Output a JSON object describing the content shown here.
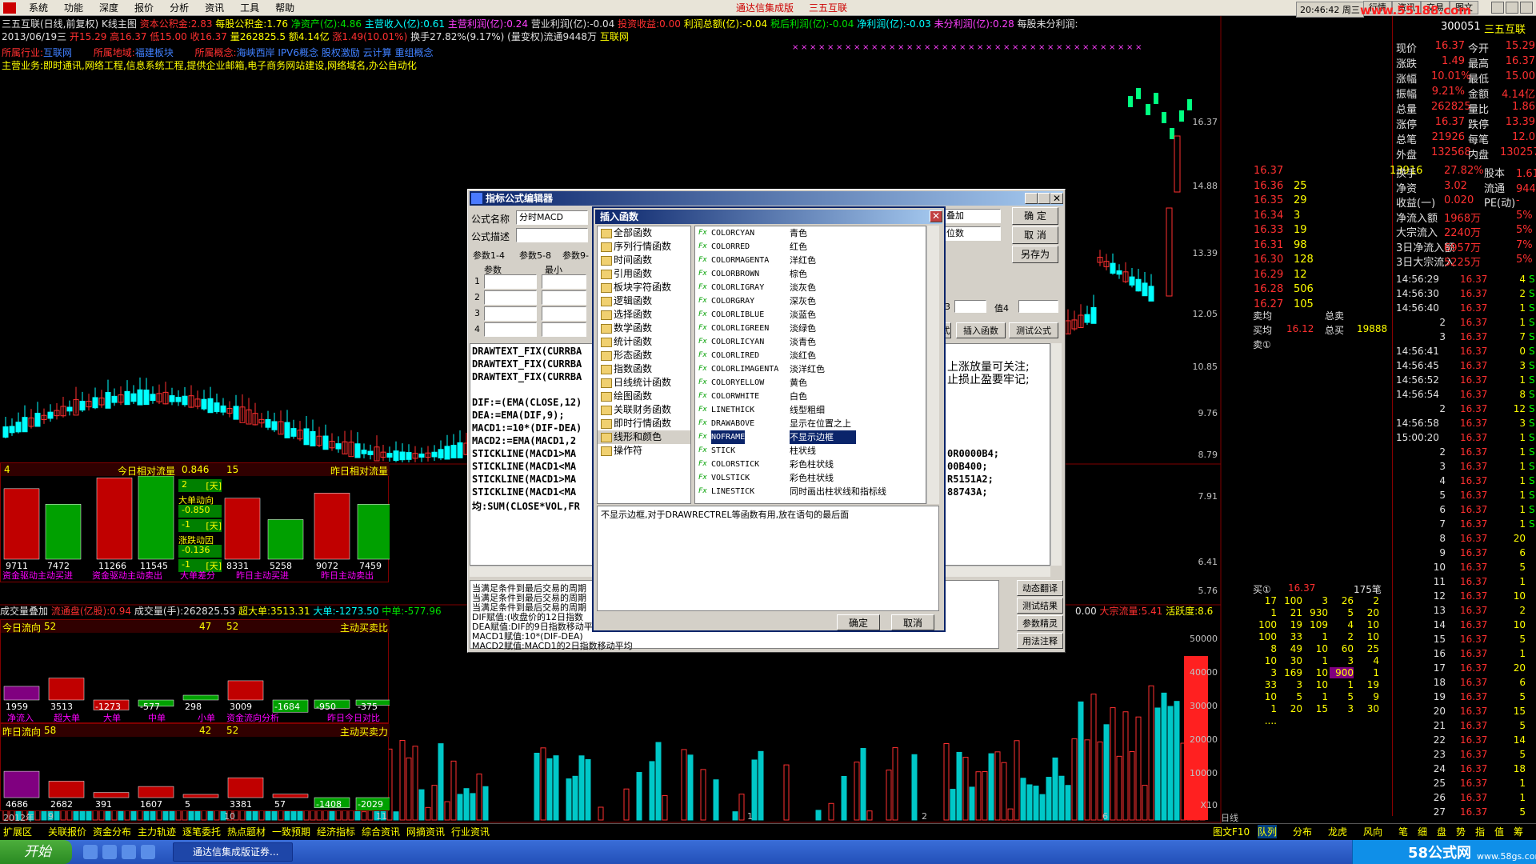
{
  "menu": {
    "items": [
      "系统",
      "功能",
      "深度",
      "报价",
      "分析",
      "资讯",
      "工具",
      "帮助"
    ],
    "center_title": "通达信集成版",
    "stock_name": "三五互联",
    "clock": "20:46:42 周三",
    "right_tabs": [
      "行情",
      "资讯",
      "交易",
      "图文"
    ]
  },
  "header": {
    "line1": {
      "stock": "三五互联(日线,前复权) K线主图",
      "f1": "资本公积金:2.83",
      "f2": "每股公积金:1.76",
      "f3": "净资产(亿):4.86",
      "f4": "主营收入(亿):0.61",
      "f5": "主营利润(亿):0.24",
      "f6": "营业利润(亿):-0.04",
      "f7": "投资收益:0.00",
      "f8": "利润总额(亿):-0.04",
      "f9": "税后利润(亿):-0.04",
      "f10": "净利润(亿):-0.03",
      "f11": "未分利润(亿):0.28",
      "f12": "每股未分利润:"
    },
    "line2": {
      "date": "2013/06/19三",
      "open": "开15.29",
      "high": "高16.37",
      "low": "低15.00",
      "close": "收16.37",
      "vol": "量262825.5",
      "amount": "额4.14亿",
      "chg": "涨1.49(10.01%)",
      "turnover": "换手27.82%(9.17%)",
      "float": "(量变权)流通9448万",
      "industry_tag": "互联网"
    },
    "line3": {
      "industry": "所属行业:",
      "industry_v": "互联网",
      "region": "所属地域:",
      "region_v": "福建板块",
      "concept": "所属概念:",
      "concept_v": "海峡西岸 IPV6概念 股权激励 云计算 重组概念"
    },
    "line4": {
      "business": "主营业务:即时通讯,网络工程,信息系统工程,提供企业邮箱,电子商务网站建设,网络域名,办公自动化"
    }
  },
  "price_axis": [
    "16.37",
    "14.88",
    "13.39",
    "12.05",
    "10.85",
    "9.76",
    "8.79",
    "7.91",
    "6.41",
    "5.76"
  ],
  "vol_axis": [
    "50000",
    "40000",
    "30000",
    "20000",
    "10000",
    "X10"
  ],
  "subpanel_top": {
    "left_title": "今日相对流量",
    "left_num": "4",
    "left_val": "0.846",
    "right_num": "15",
    "right_title": "昨日相对流量",
    "bars": [
      "9711",
      "7472",
      "11266",
      "11545",
      "8331",
      "5258",
      "9072",
      "7459"
    ],
    "labels": [
      "资金驱动主动买进",
      "资金驱动主动卖出",
      "大单差分",
      "昨日主动买进",
      "昨日主动卖出"
    ],
    "mid": [
      "2",
      "[天]",
      "大单动向",
      "-0.850",
      "-1",
      "[天]",
      "涨跌动因",
      "-0.136",
      "-1",
      "[天]"
    ]
  },
  "vol_line": {
    "text": "成交量叠加",
    "circ": "流通盘(亿股):0.94",
    "vol": "成交量(手):262825.53",
    "big": "超大单:3513.31",
    "large": "大单:-1273.50",
    "mid": "中单:-577.96",
    "right": "0.00",
    "right2": "大宗流量:5.41",
    "right3": "活跃度:8.6"
  },
  "flow_today": {
    "title": "今日流向",
    "num": "52",
    "pct": "47",
    "right_num": "52",
    "right_title": "主动买卖比",
    "vals": [
      "1959",
      "3513",
      "-1273",
      "-577",
      "298",
      "3009",
      "-1684",
      "-950",
      "-375"
    ],
    "labels": [
      "净流入",
      "超大单",
      "大单",
      "中单",
      "小单",
      "资金流向分析",
      "昨日今日对比"
    ]
  },
  "flow_yest": {
    "title": "昨日流向",
    "num": "58",
    "pct": "42",
    "right_num": "52",
    "right_title": "主动买卖力",
    "vals": [
      "4686",
      "2682",
      "391",
      "1607",
      "5",
      "3381",
      "57",
      "-1408",
      "-2029"
    ]
  },
  "date_axis": [
    "2012年",
    "9",
    "10",
    "11",
    "1",
    "2",
    "6",
    "日线"
  ],
  "bottom_tabs": [
    "扩展区",
    "关联报价",
    "资金分布",
    "主力轨迹",
    "逐笔委托",
    "热点题材",
    "一致预期",
    "经济指标",
    "综合资讯",
    "网摘资讯",
    "行业资讯"
  ],
  "right_bottom_tabs": [
    "图文F10",
    "队列",
    "分布",
    "龙虎",
    "风向",
    "笔",
    "细",
    "盘",
    "势",
    "指",
    "值",
    "筹"
  ],
  "quote": {
    "code": "300051",
    "name": "三五互联",
    "rows": [
      [
        "现价",
        "16.37",
        "今开",
        "15.29"
      ],
      [
        "涨跌",
        "1.49",
        "最高",
        "16.37"
      ],
      [
        "涨幅",
        "10.01%",
        "最低",
        "15.00"
      ],
      [
        "振幅",
        "9.21%",
        "金额",
        "4.14亿"
      ],
      [
        "总量",
        "262825",
        "量比",
        "1.86"
      ],
      [
        "涨停",
        "16.37",
        "跌停",
        "13.39"
      ],
      [
        "总笔",
        "21926",
        "每笔",
        "12.0"
      ],
      [
        "外盘",
        "132568",
        "内盘",
        "130257"
      ]
    ],
    "book": [
      [
        "16.37",
        "",
        "13916"
      ],
      [
        "16.36",
        "25",
        ""
      ],
      [
        "16.35",
        "29",
        ""
      ],
      [
        "16.34",
        "3",
        ""
      ],
      [
        "16.33",
        "19",
        ""
      ],
      [
        "16.31",
        "98",
        ""
      ],
      [
        "16.30",
        "128",
        ""
      ],
      [
        "16.29",
        "12",
        ""
      ],
      [
        "16.28",
        "506",
        ""
      ],
      [
        "16.27",
        "105",
        ""
      ]
    ],
    "stats": [
      [
        "换手",
        "27.82%",
        "股本",
        "1.61亿"
      ],
      [
        "净资",
        "3.02",
        "流通",
        "9448万"
      ],
      [
        "收益(一)",
        "0.020",
        "PE(动)",
        "-"
      ],
      [
        "净流入额",
        "1968万",
        "",
        "5%"
      ],
      [
        "大宗流入",
        "2240万",
        "",
        "5%"
      ],
      [
        "3日净流入额",
        "6957万",
        "",
        "7%"
      ],
      [
        "3日大宗流入",
        "5225万",
        "",
        "5%"
      ]
    ],
    "ask_bid": {
      "sell_avg": "卖均",
      "sell_total": "总卖",
      "buy_avg": "买均",
      "buy_avg_v": "16.12",
      "buy_total": "总买",
      "buy_total_v": "19888",
      "sell1": "卖①"
    },
    "ticks": [
      [
        "14:56:29",
        "16.37",
        "4",
        "S"
      ],
      [
        "14:56:30",
        "16.37",
        "2",
        "S"
      ],
      [
        "14:56:40",
        "16.37",
        "1",
        "S"
      ],
      [
        "2",
        "16.37",
        "1",
        "S"
      ],
      [
        "3",
        "16.37",
        "7",
        "S"
      ],
      [
        "14:56:41",
        "16.37",
        "0",
        "S"
      ],
      [
        "14:56:45",
        "16.37",
        "3",
        "S"
      ],
      [
        "14:56:52",
        "16.37",
        "1",
        "S"
      ],
      [
        "14:56:54",
        "16.37",
        "8",
        "S"
      ],
      [
        "2",
        "16.37",
        "12",
        "S"
      ],
      [
        "14:56:58",
        "16.37",
        "3",
        "S"
      ],
      [
        "15:00:20",
        "16.37",
        "1",
        "S"
      ],
      [
        "2",
        "16.37",
        "1",
        "S"
      ],
      [
        "3",
        "16.37",
        "1",
        "S"
      ],
      [
        "4",
        "16.37",
        "1",
        "S"
      ],
      [
        "5",
        "16.37",
        "1",
        "S"
      ],
      [
        "6",
        "16.37",
        "1",
        "S"
      ],
      [
        "7",
        "16.37",
        "1",
        "S"
      ],
      [
        "8",
        "16.37",
        "20",
        ""
      ],
      [
        "9",
        "16.37",
        "6",
        ""
      ],
      [
        "10",
        "16.37",
        "5",
        ""
      ],
      [
        "11",
        "16.37",
        "1",
        ""
      ],
      [
        "12",
        "16.37",
        "10",
        ""
      ],
      [
        "13",
        "16.37",
        "2",
        ""
      ],
      [
        "14",
        "16.37",
        "10",
        ""
      ],
      [
        "15",
        "16.37",
        "5",
        ""
      ],
      [
        "16",
        "16.37",
        "1",
        ""
      ],
      [
        "17",
        "16.37",
        "20",
        ""
      ],
      [
        "18",
        "16.37",
        "6",
        ""
      ],
      [
        "19",
        "16.37",
        "5",
        ""
      ],
      [
        "20",
        "16.37",
        "15",
        ""
      ],
      [
        "21",
        "16.37",
        "5",
        ""
      ],
      [
        "22",
        "16.37",
        "14",
        ""
      ],
      [
        "23",
        "16.37",
        "5",
        ""
      ],
      [
        "24",
        "16.37",
        "18",
        ""
      ],
      [
        "25",
        "16.37",
        "1",
        ""
      ],
      [
        "26",
        "16.37",
        "1",
        ""
      ],
      [
        "27",
        "16.37",
        "5",
        ""
      ]
    ],
    "queue_title": "买①",
    "queue_price": "16.37",
    "queue_count": "175笔",
    "queue": [
      [
        "17",
        "100",
        "3",
        "26",
        "2"
      ],
      [
        "1",
        "21",
        "930",
        "5",
        "20"
      ],
      [
        "100",
        "19",
        "109",
        "4",
        "10"
      ],
      [
        "100",
        "33",
        "1",
        "2",
        "10"
      ],
      [
        "8",
        "49",
        "10",
        "60",
        "25"
      ],
      [
        "10",
        "30",
        "1",
        "3",
        "4"
      ],
      [
        "3",
        "169",
        "10",
        "900",
        "1"
      ],
      [
        "33",
        "3",
        "10",
        "1",
        "19"
      ],
      [
        "10",
        "5",
        "1",
        "5",
        "9"
      ],
      [
        "1",
        "20",
        "15",
        "3",
        "30"
      ],
      [
        "....",
        "",
        "",
        "",
        ""
      ]
    ]
  },
  "editor": {
    "title": "指标公式编辑器",
    "name_lbl": "公式名称",
    "name_v": "分时MACD",
    "desc_lbl": "公式描述",
    "tabs": [
      "参数1-4",
      "参数5-8",
      "参数9-"
    ],
    "param_hdr": [
      "参数",
      "最小"
    ],
    "param_rows": [
      "1",
      "2",
      "3",
      "4"
    ],
    "right_sel1": "叠加",
    "right_sel2": "位数",
    "ok": "确  定",
    "cancel": "取  消",
    "saveas": "另存为",
    "v3": "3",
    "v4": "值4",
    "btn_insert": "插入函数",
    "btn_test": "测试公式",
    "btn_sub": "式",
    "code": [
      "DRAWTEXT_FIX(CURRBA",
      "DRAWTEXT_FIX(CURRBA",
      "DRAWTEXT_FIX(CURRBA",
      "",
      "DIF:=(EMA(CLOSE,12)",
      "DEA:=EMA(DIF,9);",
      "MACD1:=10*(DIF-DEA)",
      "MACD2:=EMA(MACD1,2",
      "STICKLINE(MACD1>MA",
      "STICKLINE(MACD1<MA",
      "STICKLINE(MACD1>MA",
      "STICKLINE(MACD1<MA",
      "均:SUM(CLOSE*VOL,FR"
    ],
    "code_right": [
      "上涨放量可关注;",
      "止损止盈要牢记;",
      "",
      "",
      "",
      "",
      "",
      "0R0000B4;",
      "00B400;",
      "R5151A2;",
      "88743A;"
    ],
    "notes": [
      "当满足条件到最后交易的周期",
      "当满足条件到最后交易的周期",
      "当满足条件到最后交易的周期",
      "DIF赋值:(收盘价的12日指数",
      "DEA赋值:DIF的9日指数移动平",
      "MACD1赋值:10*(DIF-DEA)",
      "MACD2赋值:MACD1的2日指数移动平均"
    ],
    "side_btns": [
      "动态翻译",
      "测试结果",
      "参数精灵",
      "用法注释"
    ]
  },
  "insert": {
    "title": "插入函数",
    "cats": [
      "全部函数",
      "序列行情函数",
      "时间函数",
      "引用函数",
      "板块字符函数",
      "逻辑函数",
      "选择函数",
      "数学函数",
      "统计函数",
      "形态函数",
      "指数函数",
      "日线统计函数",
      "绘图函数",
      "关联财务函数",
      "即时行情函数",
      "线形和颜色",
      "操作符"
    ],
    "fns": [
      [
        "COLORCYAN",
        "青色"
      ],
      [
        "COLORRED",
        "红色"
      ],
      [
        "COLORMAGENTA",
        "洋红色"
      ],
      [
        "COLORBROWN",
        "棕色"
      ],
      [
        "COLORLIGRAY",
        "淡灰色"
      ],
      [
        "COLORGRAY",
        "深灰色"
      ],
      [
        "COLORLIBLUE",
        "淡蓝色"
      ],
      [
        "COLORLIGREEN",
        "淡绿色"
      ],
      [
        "COLORLICYAN",
        "淡青色"
      ],
      [
        "COLORLIRED",
        "淡红色"
      ],
      [
        "COLORLIMAGENTA",
        "淡洋红色"
      ],
      [
        "COLORYELLOW",
        "黄色"
      ],
      [
        "COLORWHITE",
        "白色"
      ],
      [
        "LINETHICK",
        "线型粗细"
      ],
      [
        "DRAWABOVE",
        "显示在位置之上"
      ],
      [
        "NOFRAME",
        "不显示边框"
      ],
      [
        "STICK",
        "柱状线"
      ],
      [
        "COLORSTICK",
        "彩色柱状线"
      ],
      [
        "VOLSTICK",
        "彩色柱状线"
      ],
      [
        "LINESTICK",
        "同时画出柱状线和指标线"
      ]
    ],
    "fx": "Fx",
    "desc": "不显示边框,对于DRAWRECTREL等函数有用,放在语句的最后面",
    "ok": "确定",
    "cancel": "取消"
  },
  "taskbar": {
    "start": "开始",
    "task": "通达信集成版证券...",
    "brand": "58公式网",
    "url": "www.58gs.com"
  },
  "watermark": "www.55188.com",
  "colors": {
    "up": "#ff3030",
    "down": "#00ffff",
    "volup": "#ff3030",
    "voldown": "#00c8c8"
  }
}
